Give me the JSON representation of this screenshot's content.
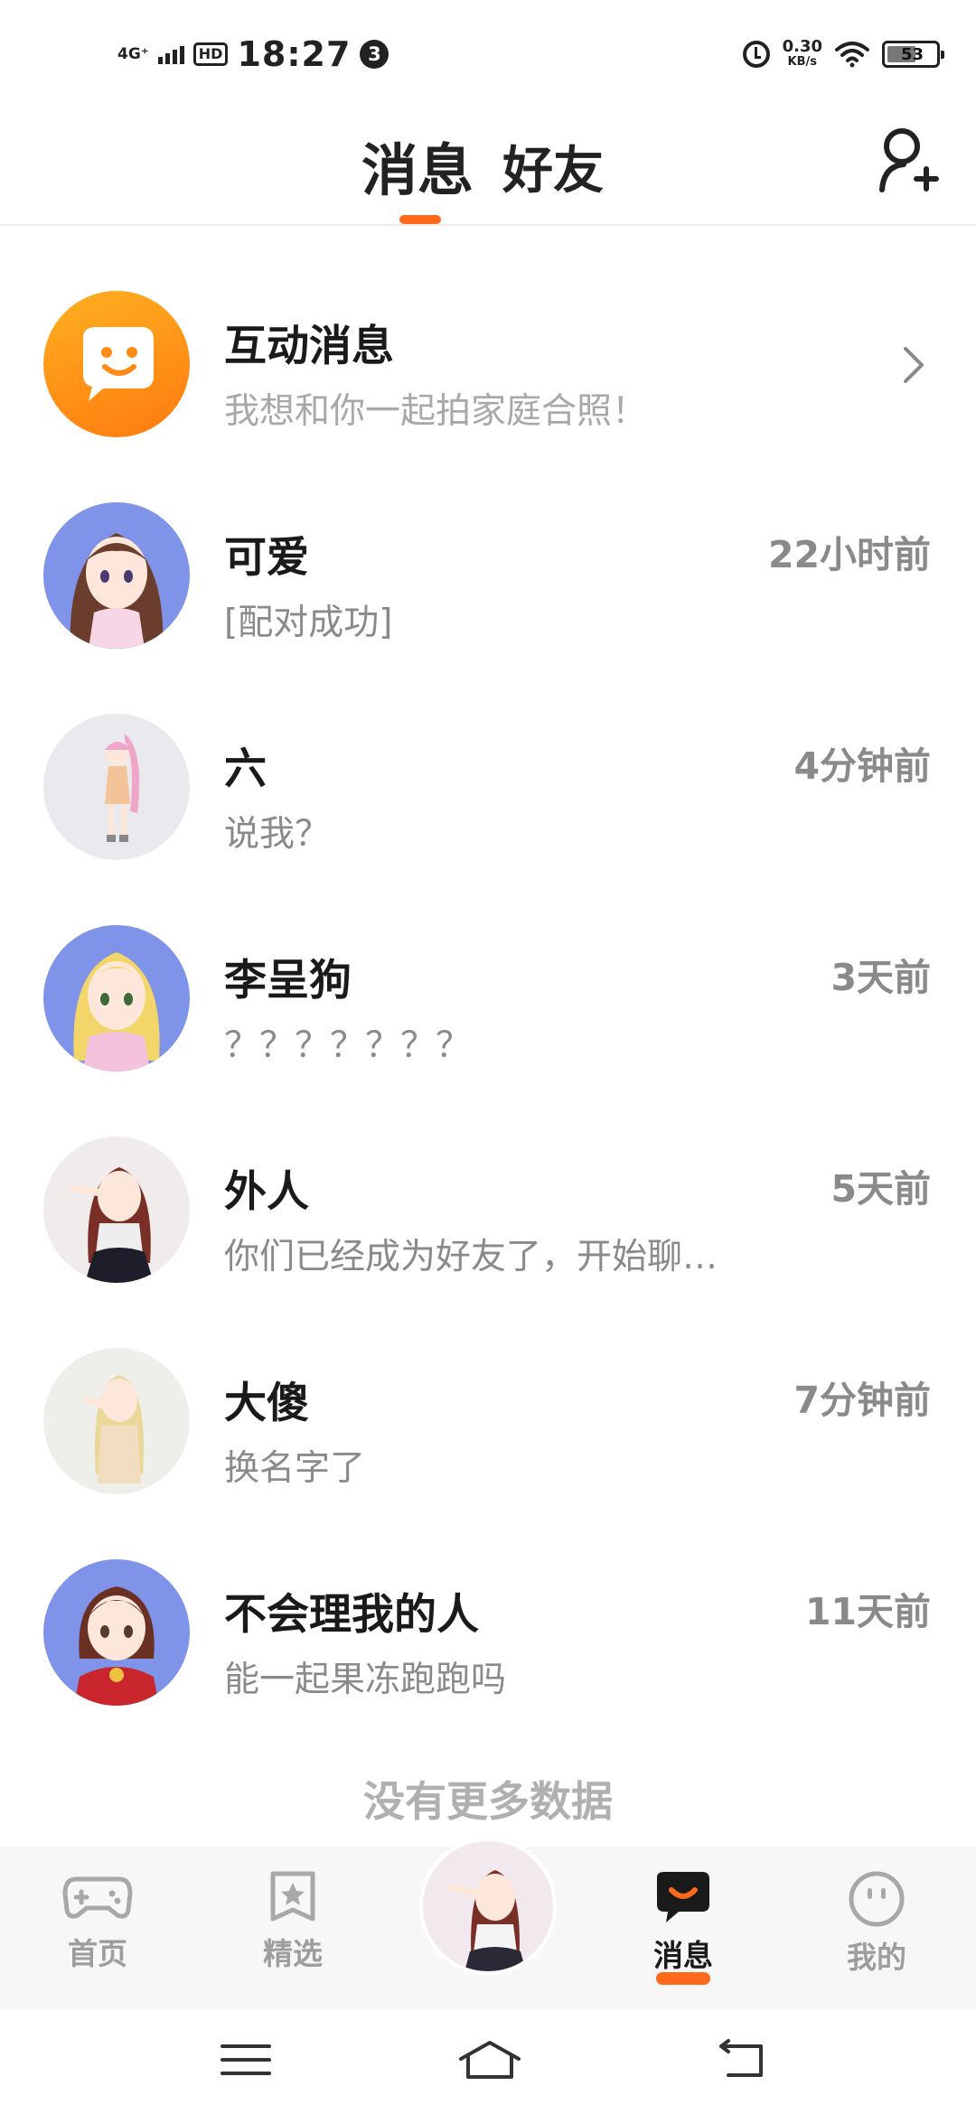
{
  "status_bar": {
    "network": "4G⁺",
    "hd_label": "HD",
    "time": "18:27",
    "notification_count": "3",
    "net_speed_value": "0.30",
    "net_speed_unit": "KB/s",
    "battery_level": "53"
  },
  "header": {
    "active_tab": "消息",
    "inactive_tab": "好友",
    "accent_color": "#ff6a1a"
  },
  "conversations": [
    {
      "name": "互动消息",
      "preview": "我想和你一起拍家庭合照！",
      "time": "",
      "avatar": "interactive-message-icon"
    },
    {
      "name": "可爱",
      "preview": "[配对成功]",
      "time": "22小时前",
      "avatar": "anime-avatar"
    },
    {
      "name": "六",
      "preview": "说我？",
      "time": "4分钟前",
      "avatar": "anime-avatar"
    },
    {
      "name": "李呈狗",
      "preview": "？？？？？？？",
      "time": "3天前",
      "avatar": "anime-avatar"
    },
    {
      "name": "外人",
      "preview": "你们已经成为好友了，开始聊…",
      "time": "5天前",
      "avatar": "anime-avatar"
    },
    {
      "name": "大傻",
      "preview": "换名字了",
      "time": "7分钟前",
      "avatar": "anime-avatar"
    },
    {
      "name": "不会理我的人",
      "preview": "能一起果冻跑跑吗",
      "time": "11天前",
      "avatar": "anime-avatar"
    }
  ],
  "list_footer": "没有更多数据",
  "bottom_nav": {
    "home": "首页",
    "featured": "精选",
    "messages": "消息",
    "mine": "我的"
  }
}
